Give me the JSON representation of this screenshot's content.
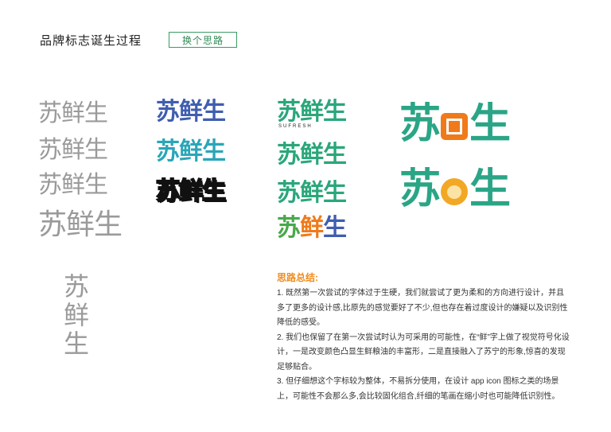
{
  "header": {
    "title": "品牌标志诞生过程",
    "switch_button": "换个思路"
  },
  "logos": {
    "text": "苏鲜生",
    "chars": [
      "苏",
      "鲜",
      "生"
    ],
    "sub_text": "SUFRESH"
  },
  "colors": {
    "gray": "#9a9a9a",
    "blue": "#3f5eb0",
    "teal": "#2aa6b8",
    "green": "#2aa585",
    "orange": "#f07a1a",
    "accent": "#f08c1e"
  },
  "summary": {
    "title": "思路总结:",
    "paragraphs": [
      "1. 既然第一次尝试的字体过于生硬，我们就尝试了更为柔和的方向进行设计，并且多了更多的设计感,比原先的感觉要好了不少,但也存在着过度设计的嫌疑以及识别性降低的感受。",
      "2. 我们也保留了在第一次尝试时认为可采用的可能性，在“鲜”字上做了视觉符号化设计，一是改变颜色凸显生鲜粮油的丰富形，二是直接融入了苏宁的形象,惊喜的发现足够贴合。",
      "3. 但仔细想这个字标较为整体，不易拆分使用，在设计 app icon 图标之类的场景上，可能性不会那么多,会比较固化组合,纤细的笔画在缩小时也可能降低识别性。"
    ]
  }
}
